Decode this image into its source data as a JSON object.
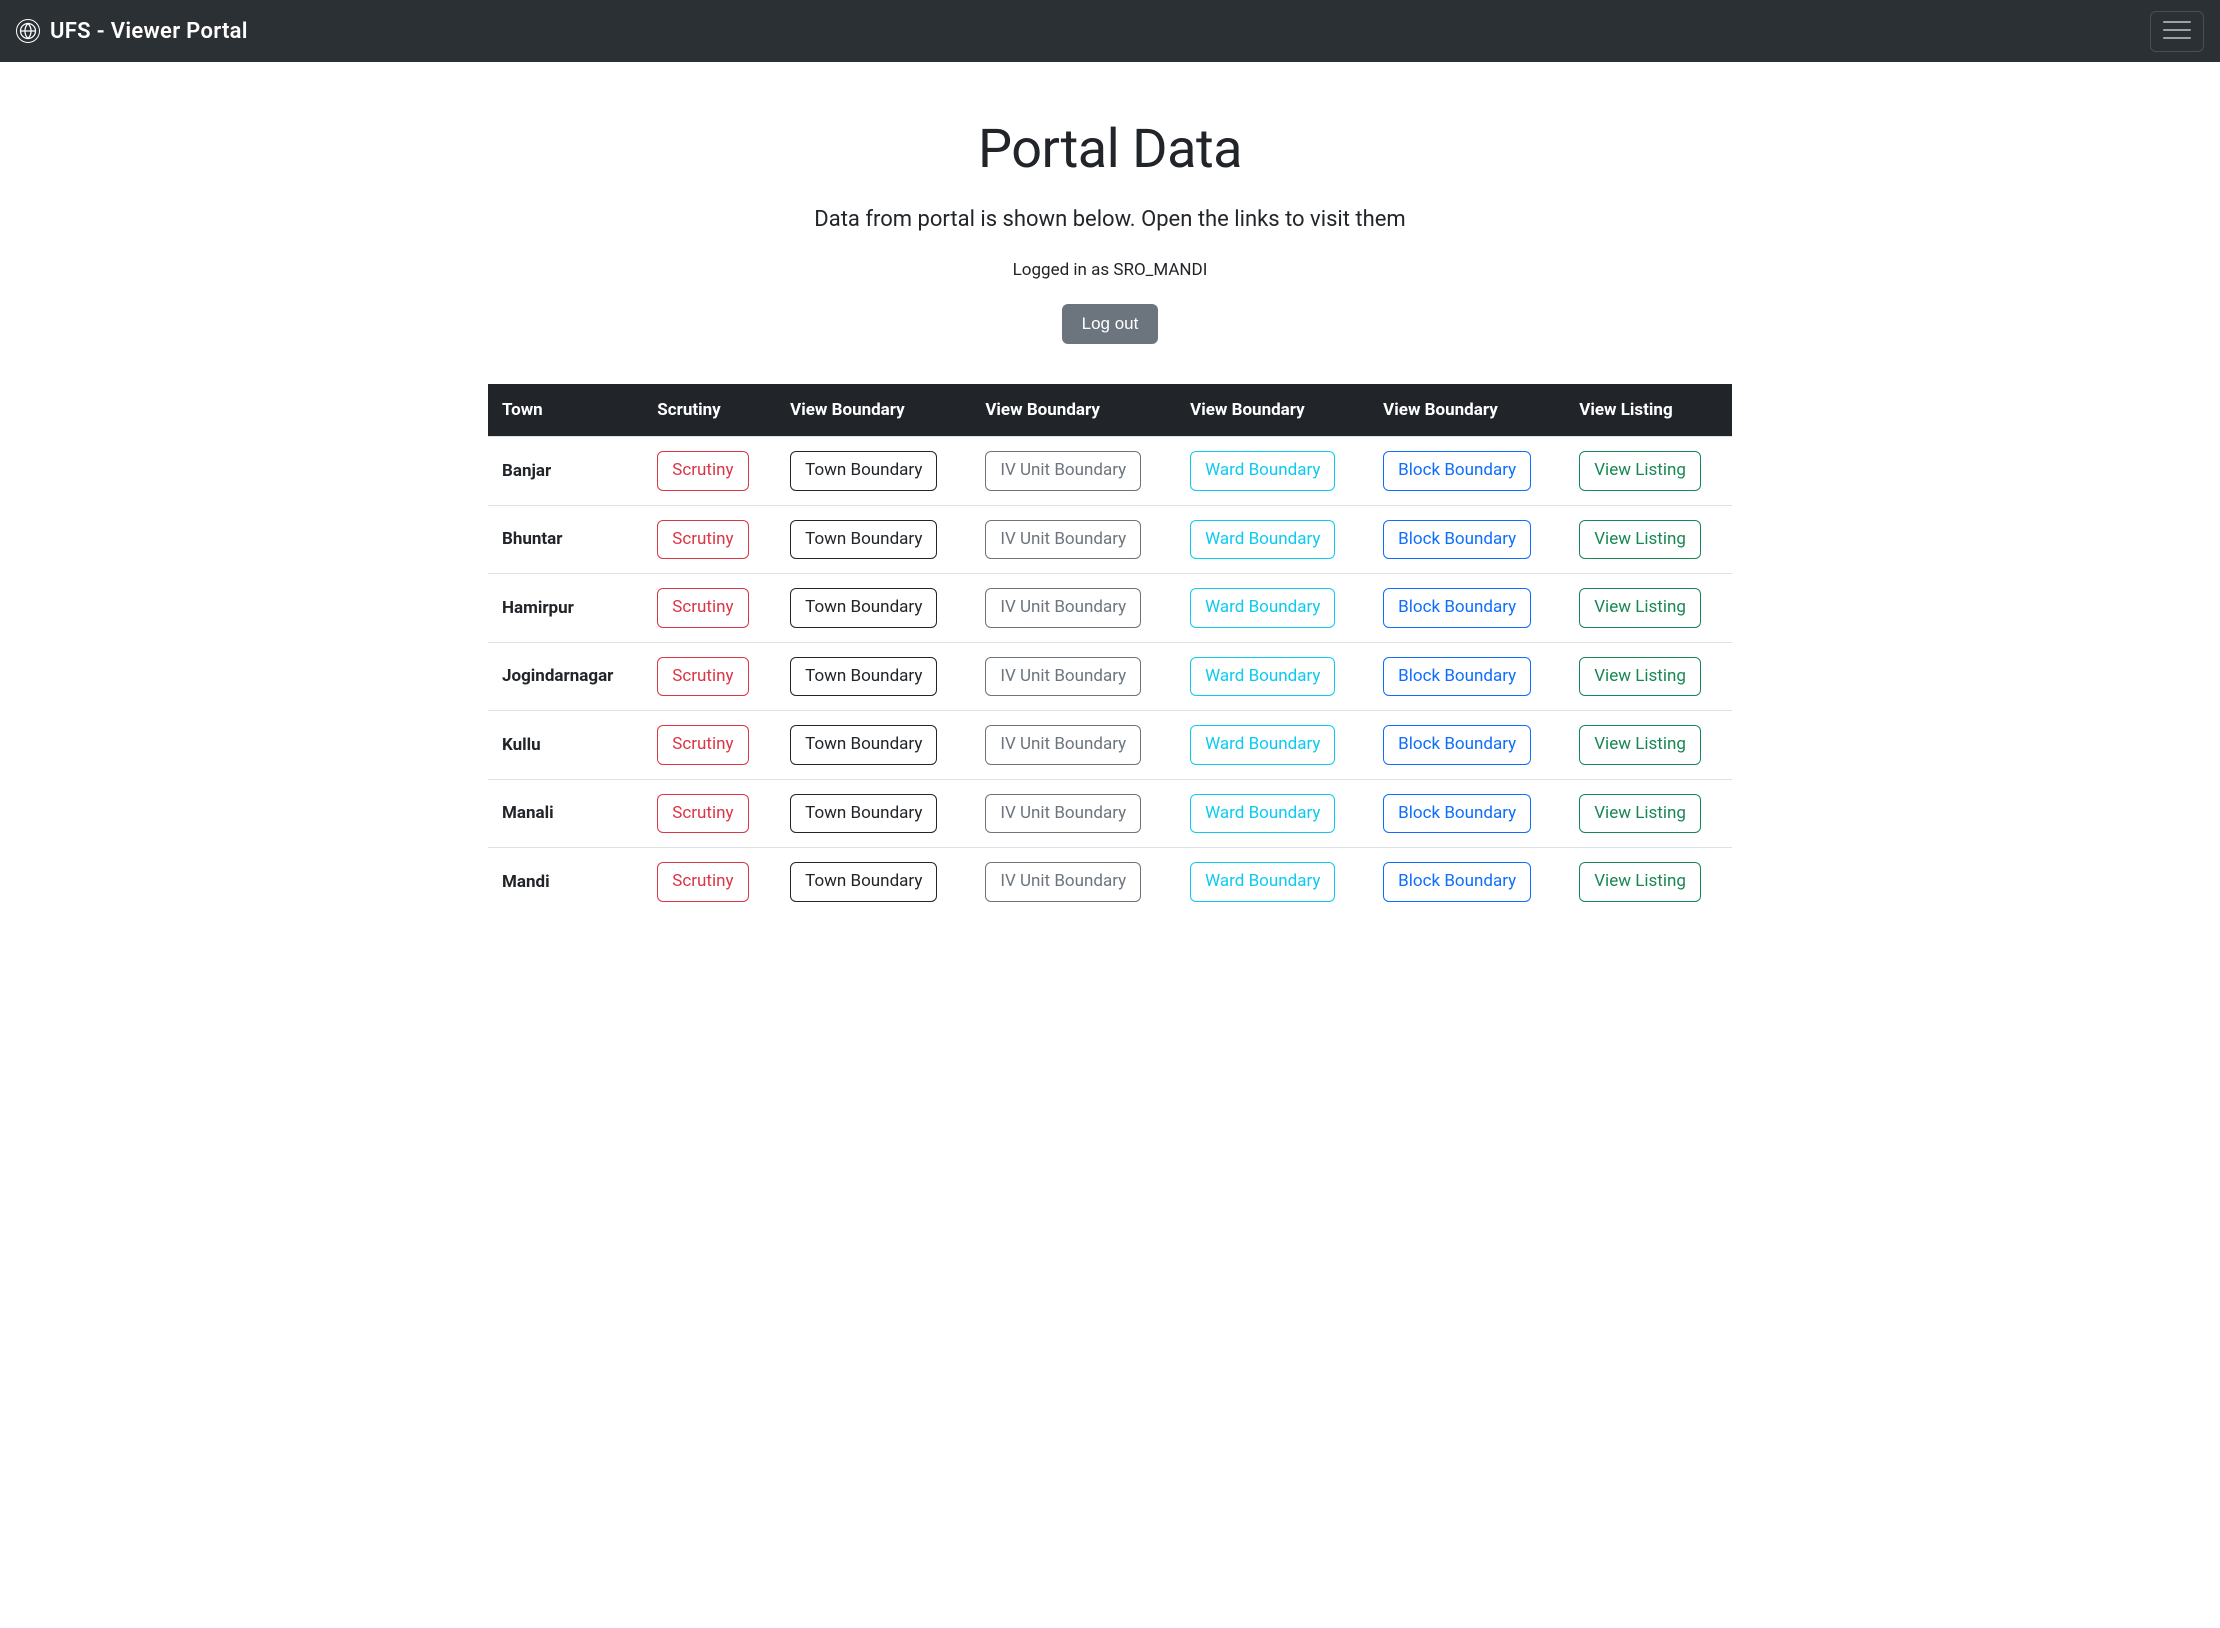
{
  "navbar": {
    "brand_text": "UFS - Viewer Portal"
  },
  "header": {
    "title": "Portal Data",
    "subtitle": "Data from portal is shown below. Open the links to visit them",
    "user_prefix": "Logged in as ",
    "user": "SRO_MANDI",
    "logout_label": "Log out"
  },
  "table": {
    "columns": [
      "Town",
      "Scrutiny",
      "View Boundary",
      "View Boundary",
      "View Boundary",
      "View Boundary",
      "View Listing"
    ],
    "button_labels": {
      "scrutiny": "Scrutiny",
      "town_boundary": "Town Boundary",
      "iv_unit_boundary": "IV Unit Boundary",
      "ward_boundary": "Ward Boundary",
      "block_boundary": "Block Boundary",
      "view_listing": "View Listing"
    },
    "rows": [
      {
        "town": "Banjar"
      },
      {
        "town": "Bhuntar"
      },
      {
        "town": "Hamirpur"
      },
      {
        "town": "Jogindarnagar"
      },
      {
        "town": "Kullu"
      },
      {
        "town": "Manali"
      },
      {
        "town": "Mandi"
      }
    ]
  },
  "colors": {
    "navbar_bg": "#2b3035",
    "thead_bg": "#212529",
    "danger": "#dc3545",
    "dark": "#212529",
    "secondary": "#6c757d",
    "info": "#0dcaf0",
    "primary": "#0d6efd",
    "success": "#198754"
  }
}
